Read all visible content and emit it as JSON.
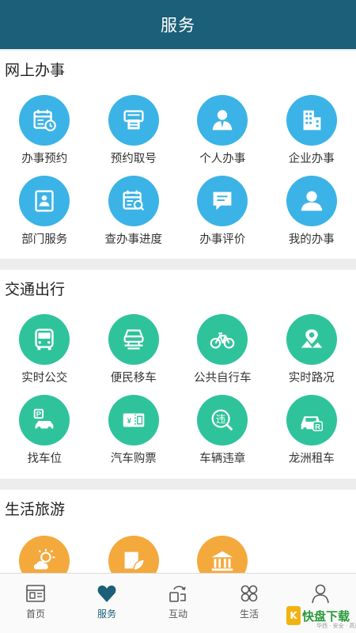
{
  "header": {
    "title": "服务"
  },
  "sections": [
    {
      "title": "网上办事",
      "items": [
        {
          "label": "办事预约",
          "icon": "calendar-clock-icon",
          "color": "#3bb3e6"
        },
        {
          "label": "预约取号",
          "icon": "ticket-machine-icon",
          "color": "#3bb3e6"
        },
        {
          "label": "个人办事",
          "icon": "person-suit-icon",
          "color": "#3bb3e6"
        },
        {
          "label": "企业办事",
          "icon": "building-icon",
          "color": "#3bb3e6"
        },
        {
          "label": "部门服务",
          "icon": "id-document-icon",
          "color": "#3bb3e6"
        },
        {
          "label": "查办事进度",
          "icon": "calendar-search-icon",
          "color": "#3bb3e6"
        },
        {
          "label": "办事评价",
          "icon": "comment-icon",
          "color": "#3bb3e6"
        },
        {
          "label": "我的办事",
          "icon": "user-icon",
          "color": "#3bb3e6"
        }
      ]
    },
    {
      "title": "交通出行",
      "items": [
        {
          "label": "实时公交",
          "icon": "bus-icon",
          "color": "#2fc39b"
        },
        {
          "label": "便民移车",
          "icon": "tow-car-icon",
          "color": "#2fc39b"
        },
        {
          "label": "公共自行车",
          "icon": "bicycle-icon",
          "color": "#2fc39b"
        },
        {
          "label": "实时路况",
          "icon": "map-pin-icon",
          "color": "#2fc39b"
        },
        {
          "label": "找车位",
          "icon": "parking-icon",
          "color": "#2fc39b"
        },
        {
          "label": "汽车购票",
          "icon": "bus-ticket-icon",
          "color": "#2fc39b"
        },
        {
          "label": "车辆违章",
          "icon": "violation-search-icon",
          "color": "#2fc39b",
          "glyph": "违"
        },
        {
          "label": "龙洲租车",
          "icon": "car-rental-icon",
          "color": "#2fc39b",
          "glyph": "R"
        }
      ]
    },
    {
      "title": "生活旅游",
      "items": [
        {
          "icon": "weather-icon",
          "color": "#f4a93c"
        },
        {
          "icon": "leaf-card-icon",
          "color": "#f4a93c"
        },
        {
          "icon": "museum-icon",
          "color": "#f4a93c"
        }
      ]
    }
  ],
  "tabbar": [
    {
      "label": "首页",
      "icon": "home-news-icon"
    },
    {
      "label": "服务",
      "icon": "heart-icon",
      "active": true
    },
    {
      "label": "互动",
      "icon": "exchange-icon"
    },
    {
      "label": "生活",
      "icon": "grid-circles-icon"
    },
    {
      "label": "",
      "icon": "profile-icon"
    }
  ],
  "watermark": {
    "mark": "K",
    "text": "快盘下载",
    "sub": "华西 · 安全 · 高速"
  },
  "colors": {
    "header": "#1b5f78",
    "blue": "#3bb3e6",
    "green": "#2fc39b",
    "orange": "#f4a93c"
  }
}
